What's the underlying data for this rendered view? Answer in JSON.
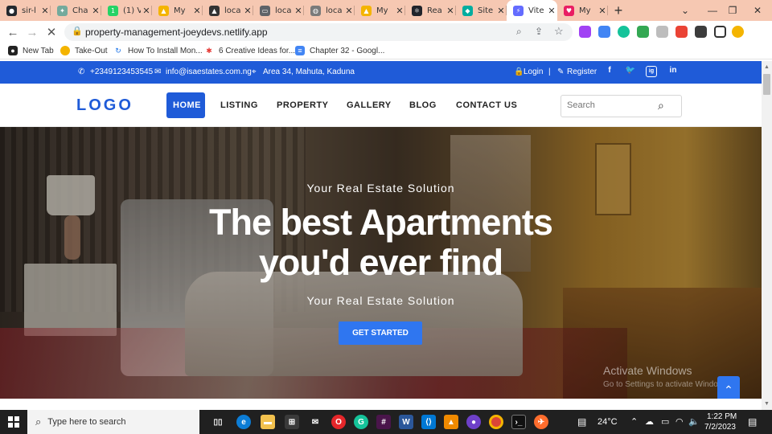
{
  "browser": {
    "tabs": [
      {
        "title": "sir-l",
        "color": "#24292f",
        "glyph": "●"
      },
      {
        "title": "Cha",
        "color": "#74aa9c",
        "glyph": "✦"
      },
      {
        "title": "(1) V",
        "color": "#25d366",
        "glyph": "1"
      },
      {
        "title": "My",
        "color": "#f4b400",
        "glyph": "▲"
      },
      {
        "title": "loca",
        "color": "#333333",
        "glyph": "▲"
      },
      {
        "title": "loca",
        "color": "#5f6368",
        "glyph": "▭"
      },
      {
        "title": "loca",
        "color": "#7a7a7a",
        "glyph": "◍"
      },
      {
        "title": "My",
        "color": "#f4b400",
        "glyph": "▲"
      },
      {
        "title": "Rea",
        "color": "#20232a",
        "glyph": "⚛"
      },
      {
        "title": "Site",
        "color": "#00ad9f",
        "glyph": "◆"
      },
      {
        "title": "Vite",
        "color": "#646cff",
        "glyph": "⚡",
        "active": true
      },
      {
        "title": "My",
        "color": "#e91e63",
        "glyph": "♥"
      }
    ],
    "url": "property-management-joeydevs.netlify.app",
    "bookmarks": [
      "New Tab",
      "Take-Out",
      "How To Install Mon...",
      "6 Creative Ideas for...",
      "Chapter 32 - Googl..."
    ]
  },
  "topbar": {
    "phone": "+2349123453545",
    "email": "info@isaestates.com.ng",
    "address": "Area 34, Mahuta, Kaduna",
    "login": "Login",
    "separator": "|",
    "register": "Register",
    "social": [
      "f",
      "t",
      "ig",
      "in"
    ]
  },
  "header": {
    "logo": "LOGO",
    "nav": [
      "HOME",
      "LISTING",
      "PROPERTY",
      "GALLERY",
      "BLOG",
      "CONTACT US"
    ],
    "search_placeholder": "Search"
  },
  "hero": {
    "eyebrow_top": "Your Real Estate Solution",
    "title_line1": "The best Apartments",
    "title_line2": "you'd ever find",
    "eyebrow_bottom": "Your Real Estate Solution",
    "cta": "GET STARTED",
    "watermark_title": "Activate Windows",
    "watermark_sub": "Go to Settings to activate Windows."
  },
  "taskbar": {
    "search_placeholder": "Type here to search",
    "weather": "24°C",
    "time": "1:22 PM",
    "date": "7/2/2023"
  }
}
